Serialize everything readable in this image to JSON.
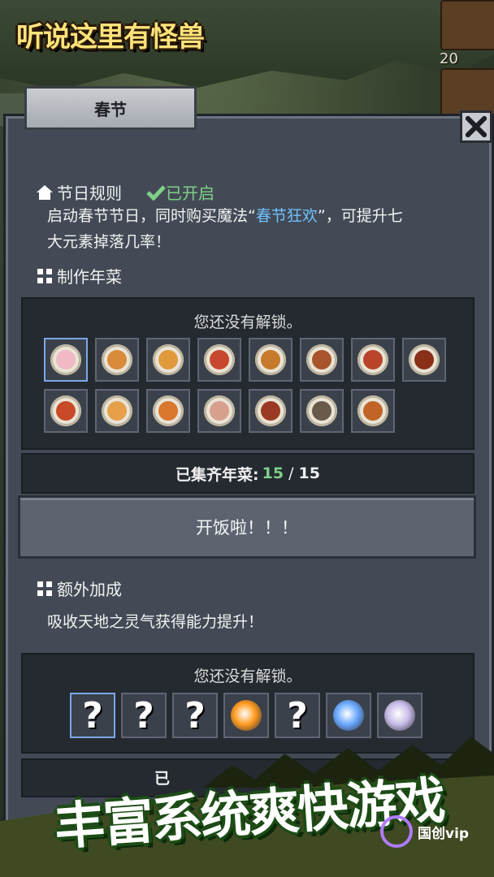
{
  "game": {
    "logo_text": "听说这里有怪兽"
  },
  "top_resources": {
    "count": "20"
  },
  "dialog": {
    "tab_label": "春节",
    "close_icon": "close-x-icon"
  },
  "festival_rules": {
    "heading": "节日规则",
    "status": "已开启",
    "desc_line1_before": "启动春节节日，同时购买魔法“",
    "desc_highlight": "春节狂欢",
    "desc_line1_after": "”，可提升七",
    "desc_line2": "大元素掉落几率！"
  },
  "new_year_dishes": {
    "heading": "制作年菜",
    "locked_text": "您还没有解锁。",
    "dishes": [
      {
        "color": "#f0b9c4"
      },
      {
        "color": "#d98a3a"
      },
      {
        "color": "#e09a3c"
      },
      {
        "color": "#c8482e"
      },
      {
        "color": "#c77a2b"
      },
      {
        "color": "#a8542c"
      },
      {
        "color": "#b8452a"
      },
      {
        "color": "#8a2f18"
      },
      {
        "color": "#c94a26"
      },
      {
        "color": "#e7a04a"
      },
      {
        "color": "#d9772e"
      },
      {
        "color": "#d7a08c"
      },
      {
        "color": "#9b3a22"
      },
      {
        "color": "#6a5a4a"
      },
      {
        "color": "#c06428"
      }
    ],
    "collected_label": "已集齐年菜:",
    "collected": "15",
    "separator": "/",
    "total": "15",
    "feast_button": "开饭啦！！！"
  },
  "extra_bonus": {
    "heading": "额外加成",
    "desc": "吸收天地之灵气获得能力提升！",
    "locked_text": "您还没有解锁。",
    "slots": [
      {
        "type": "unknown",
        "mark": "?"
      },
      {
        "type": "unknown",
        "mark": "?"
      },
      {
        "type": "unknown",
        "mark": "?"
      },
      {
        "type": "fire-orb",
        "color": "#ff9a1f"
      },
      {
        "type": "unknown",
        "mark": "?"
      },
      {
        "type": "water-orb",
        "color": "#6aa8ff"
      },
      {
        "type": "spirit-orb",
        "color": "#c8bce8"
      }
    ],
    "bottom_label_partial": "已"
  },
  "promo_banner": {
    "text": "丰富系统爽快游戏"
  },
  "watermark": {
    "text": "国创vip"
  },
  "colors": {
    "enabled_green": "#7fd089",
    "highlight_blue": "#6fc2ff",
    "panel": "#434a55"
  }
}
